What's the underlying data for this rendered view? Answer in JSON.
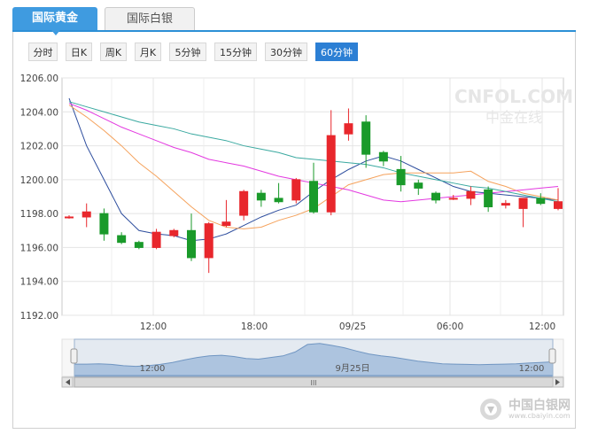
{
  "tabs": [
    {
      "label": "国际黄金",
      "active": true
    },
    {
      "label": "国际白银",
      "active": false
    }
  ],
  "periods": [
    {
      "label": "分时",
      "selected": false
    },
    {
      "label": "日K",
      "selected": false
    },
    {
      "label": "周K",
      "selected": false
    },
    {
      "label": "月K",
      "selected": false
    },
    {
      "label": "5分钟",
      "selected": false
    },
    {
      "label": "15分钟",
      "selected": false
    },
    {
      "label": "30分钟",
      "selected": false
    },
    {
      "label": "60分钟",
      "selected": true
    }
  ],
  "watermark": {
    "brand": "CNFOL.COM",
    "sub": "中金在线"
  },
  "footer_logo": {
    "name": "中国白银网",
    "url": "www.cbaiyin.com"
  },
  "colors": {
    "up": "#e8272c",
    "down": "#1a9a2a",
    "line1": "#2e4e9e",
    "line2": "#f5a25c",
    "line3": "#e338e0",
    "line4": "#3aa9a0"
  },
  "chart_data": {
    "type": "candlestick",
    "ylim": [
      1192,
      1206
    ],
    "yticks": [
      "1206.00",
      "1204.00",
      "1202.00",
      "1200.00",
      "1198.00",
      "1196.00",
      "1194.00",
      "1192.00"
    ],
    "xticks": [
      "12:00",
      "18:00",
      "09/25",
      "06:00",
      "12:00"
    ],
    "candles": [
      {
        "o": 1197.8,
        "h": 1197.9,
        "l": 1197.7,
        "c": 1197.8
      },
      {
        "o": 1197.8,
        "h": 1198.6,
        "l": 1197.2,
        "c": 1198.1
      },
      {
        "o": 1198.0,
        "h": 1198.3,
        "l": 1196.4,
        "c": 1196.8
      },
      {
        "o": 1196.7,
        "h": 1196.9,
        "l": 1196.2,
        "c": 1196.3
      },
      {
        "o": 1196.3,
        "h": 1196.4,
        "l": 1195.9,
        "c": 1196.0
      },
      {
        "o": 1196.0,
        "h": 1197.1,
        "l": 1195.9,
        "c": 1196.9
      },
      {
        "o": 1196.7,
        "h": 1197.1,
        "l": 1196.6,
        "c": 1197.0
      },
      {
        "o": 1197.0,
        "h": 1198.0,
        "l": 1195.2,
        "c": 1195.4
      },
      {
        "o": 1195.4,
        "h": 1197.5,
        "l": 1194.5,
        "c": 1197.4
      },
      {
        "o": 1197.3,
        "h": 1198.8,
        "l": 1197.2,
        "c": 1197.5
      },
      {
        "o": 1197.9,
        "h": 1199.4,
        "l": 1197.6,
        "c": 1199.3
      },
      {
        "o": 1199.2,
        "h": 1199.4,
        "l": 1198.4,
        "c": 1198.8
      },
      {
        "o": 1198.9,
        "h": 1199.8,
        "l": 1198.6,
        "c": 1198.7
      },
      {
        "o": 1198.8,
        "h": 1200.1,
        "l": 1198.6,
        "c": 1200.0
      },
      {
        "o": 1199.9,
        "h": 1201.0,
        "l": 1198.0,
        "c": 1198.1
      },
      {
        "o": 1198.1,
        "h": 1204.1,
        "l": 1197.9,
        "c": 1202.6
      },
      {
        "o": 1202.7,
        "h": 1204.2,
        "l": 1202.3,
        "c": 1203.3
      },
      {
        "o": 1203.4,
        "h": 1203.8,
        "l": 1200.7,
        "c": 1201.5
      },
      {
        "o": 1201.6,
        "h": 1201.7,
        "l": 1200.8,
        "c": 1201.1
      },
      {
        "o": 1200.6,
        "h": 1201.4,
        "l": 1199.3,
        "c": 1199.7
      },
      {
        "o": 1199.8,
        "h": 1200.0,
        "l": 1199.1,
        "c": 1199.5
      },
      {
        "o": 1199.2,
        "h": 1199.3,
        "l": 1198.6,
        "c": 1198.8
      },
      {
        "o": 1198.9,
        "h": 1199.1,
        "l": 1198.8,
        "c": 1198.9
      },
      {
        "o": 1198.9,
        "h": 1199.6,
        "l": 1198.5,
        "c": 1199.3
      },
      {
        "o": 1199.4,
        "h": 1199.6,
        "l": 1198.1,
        "c": 1198.4
      },
      {
        "o": 1198.5,
        "h": 1198.8,
        "l": 1198.3,
        "c": 1198.6
      },
      {
        "o": 1198.3,
        "h": 1198.9,
        "l": 1197.2,
        "c": 1198.9
      },
      {
        "o": 1198.9,
        "h": 1199.2,
        "l": 1198.5,
        "c": 1198.6
      },
      {
        "o": 1198.3,
        "h": 1199.5,
        "l": 1198.2,
        "c": 1198.7
      }
    ],
    "ma_lines": [
      {
        "color": "#2e4e9e",
        "values": [
          1204.8,
          1202.0,
          1200.0,
          1198.0,
          1197.0,
          1196.8,
          1196.7,
          1196.4,
          1196.5,
          1196.8,
          1197.3,
          1197.8,
          1198.2,
          1198.5,
          1199.3,
          1200.0,
          1200.6,
          1201.1,
          1201.4,
          1201.1,
          1200.6,
          1200.1,
          1199.6,
          1199.3,
          1199.2,
          1199.1,
          1199.0,
          1198.9,
          1198.8
        ]
      },
      {
        "color": "#f5a25c",
        "values": [
          1204.4,
          1203.7,
          1202.9,
          1202.0,
          1201.0,
          1200.2,
          1199.3,
          1198.4,
          1197.6,
          1197.2,
          1197.1,
          1197.2,
          1197.6,
          1197.9,
          1198.3,
          1199.0,
          1199.7,
          1200.0,
          1200.3,
          1200.4,
          1200.4,
          1200.4,
          1200.4,
          1200.5,
          1199.9,
          1199.6,
          1199.2,
          1199.0,
          1198.8
        ]
      },
      {
        "color": "#e338e0",
        "values": [
          1204.5,
          1204.1,
          1203.6,
          1203.1,
          1202.7,
          1202.3,
          1201.9,
          1201.6,
          1201.2,
          1201.0,
          1200.8,
          1200.5,
          1200.2,
          1200.0,
          1199.8,
          1199.6,
          1199.4,
          1199.1,
          1198.8,
          1198.7,
          1198.8,
          1198.9,
          1199.0,
          1199.1,
          1199.2,
          1199.3,
          1199.4,
          1199.5,
          1199.6
        ]
      },
      {
        "color": "#3aa9a0",
        "values": [
          1204.6,
          1204.3,
          1204.0,
          1203.7,
          1203.4,
          1203.2,
          1203.0,
          1202.7,
          1202.5,
          1202.3,
          1202.0,
          1201.8,
          1201.6,
          1201.3,
          1201.2,
          1201.1,
          1201.0,
          1200.9,
          1200.7,
          1200.4,
          1200.2,
          1200.0,
          1199.8,
          1199.6,
          1199.5,
          1199.3,
          1199.1,
          1198.9,
          1198.7
        ]
      }
    ],
    "navigator": {
      "labels": [
        "12:00",
        "9月25日",
        "12:00"
      ],
      "scroll_glyph": "III"
    }
  }
}
